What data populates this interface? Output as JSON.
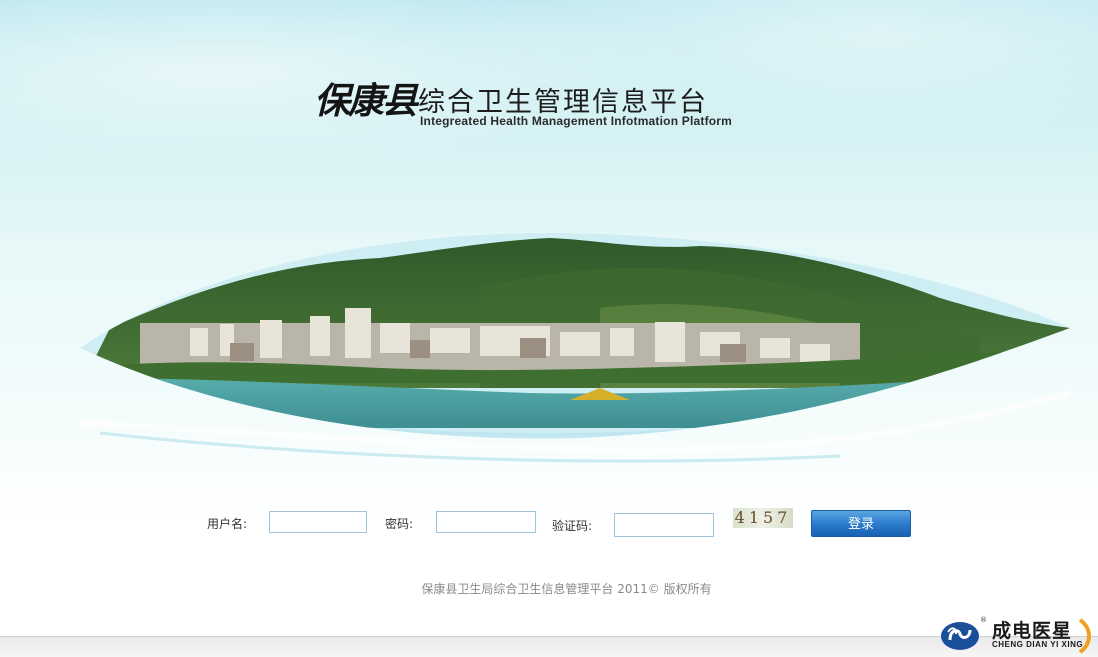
{
  "header": {
    "brand_calligraphy": "保康县",
    "title": "综合卫生管理信息平台",
    "subtitle_en": "Integreated Health Management Infotmation Platform"
  },
  "login_form": {
    "username_label": "用户名:",
    "username_value": "",
    "password_label": "密码:",
    "password_value": "",
    "captcha_label": "验证码:",
    "captcha_value": "",
    "captcha_image_text": "4157",
    "submit_label": "登录"
  },
  "footer": {
    "copyright": "保康县卫生局综合卫生信息管理平台 2011© 版权所有"
  },
  "vendor_logo": {
    "name_cn": "成电医星",
    "name_en": "CHENG DIAN YI XING",
    "registered_mark": "®"
  },
  "colors": {
    "accent_button": "#2d7ccc",
    "input_border": "#9fc4dc",
    "sky_top": "#bfe9f0",
    "water": "#4ea6a8"
  }
}
